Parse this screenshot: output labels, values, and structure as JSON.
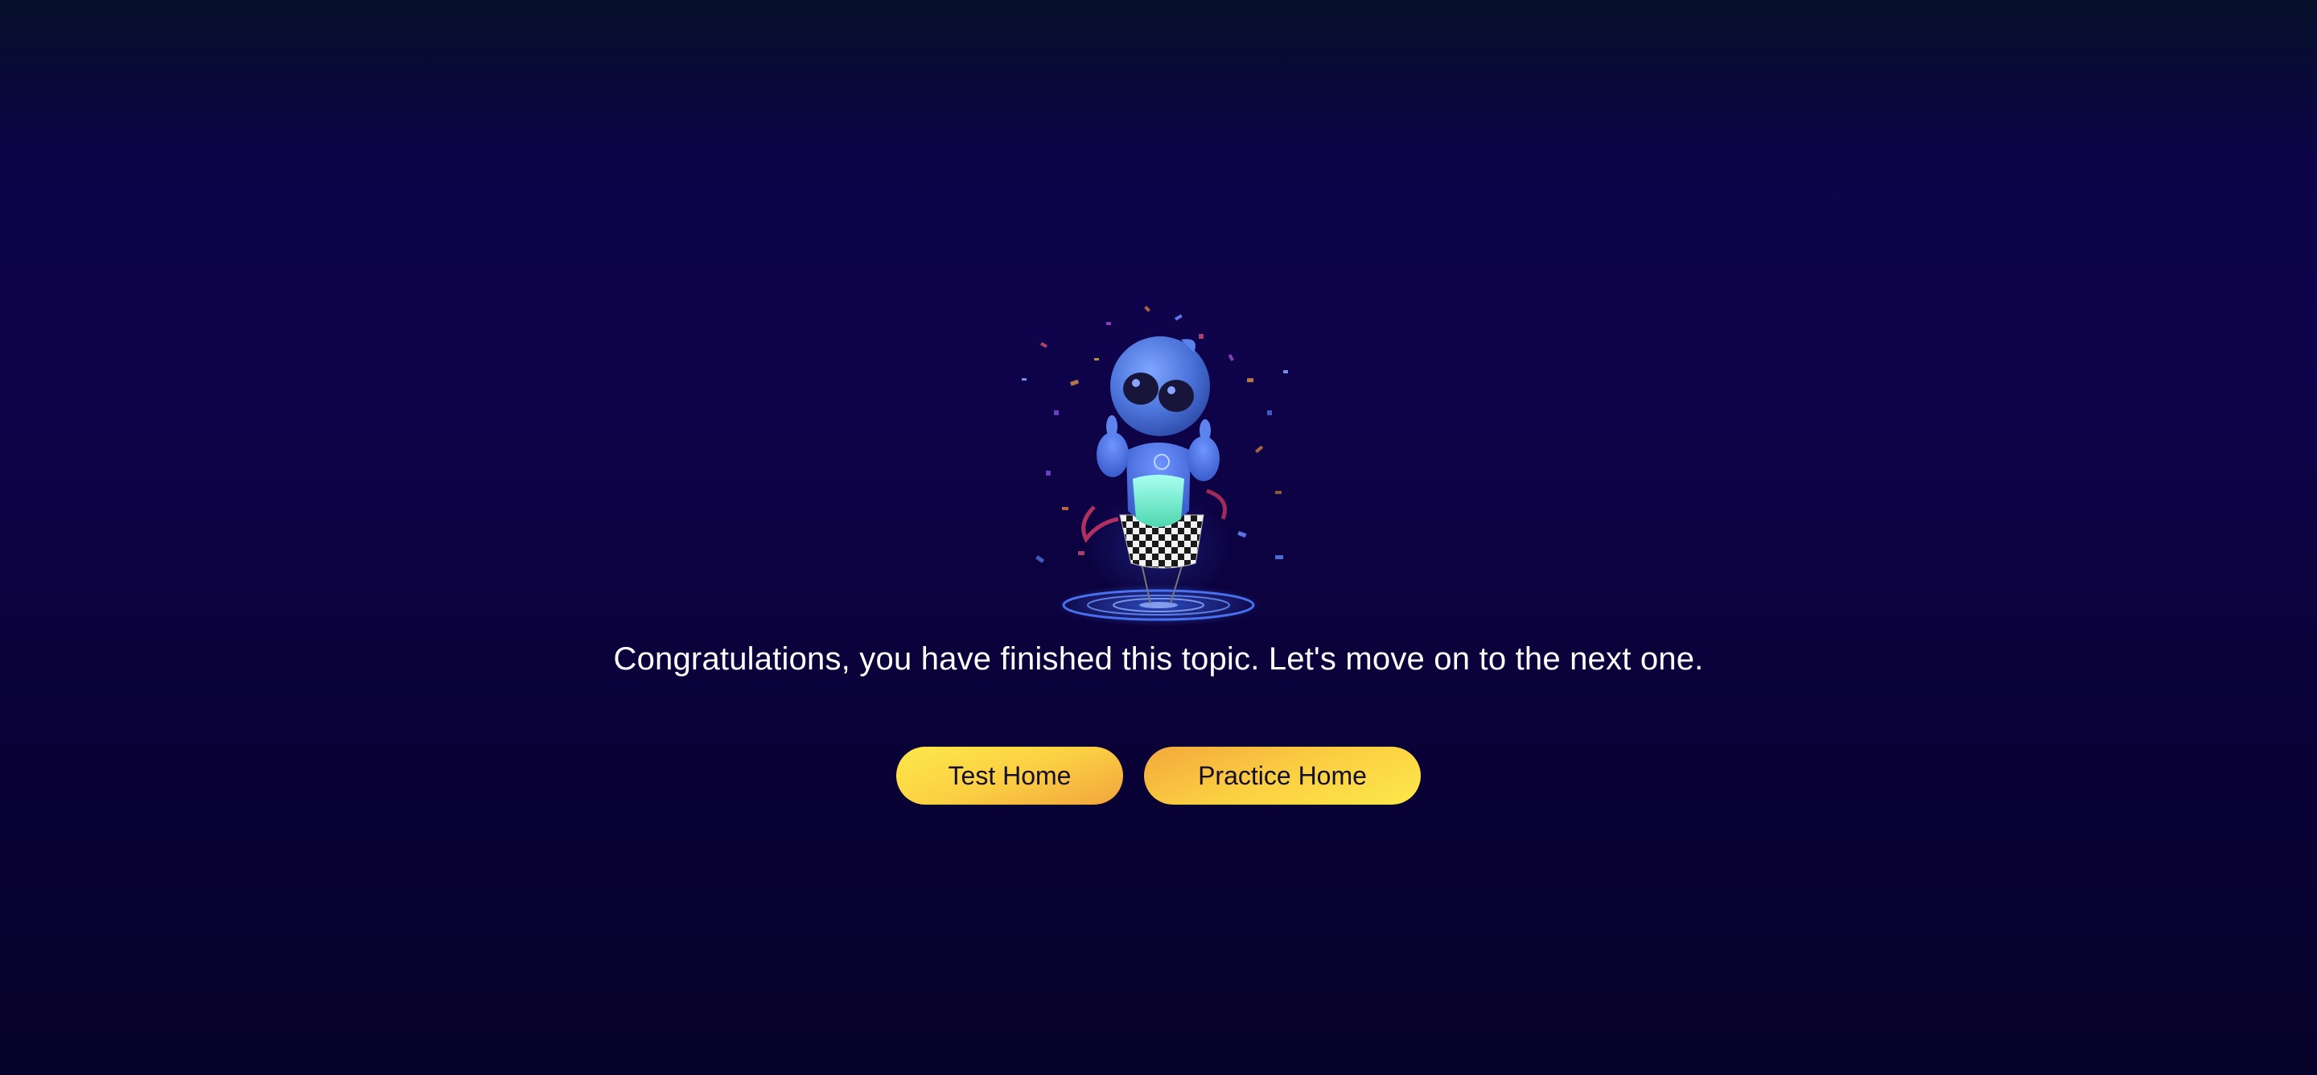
{
  "illustration": {
    "name": "celebrating-robot-mascot",
    "colors": {
      "body": "#4a78e0",
      "belly": "#7fe8c8",
      "eye": "#17163a",
      "platform_glow": "#3d6cff"
    }
  },
  "message": "Congratulations, you have finished this topic. Let's move on to the next one.",
  "buttons": {
    "test_home": "Test Home",
    "practice_home": "Practice Home"
  },
  "colors": {
    "background_top": "#06102a",
    "background_mid": "#0f034c",
    "background_bottom": "#07022a",
    "button_yellow": "#fde84a",
    "button_orange": "#f2a43c",
    "text": "#ffffff"
  }
}
